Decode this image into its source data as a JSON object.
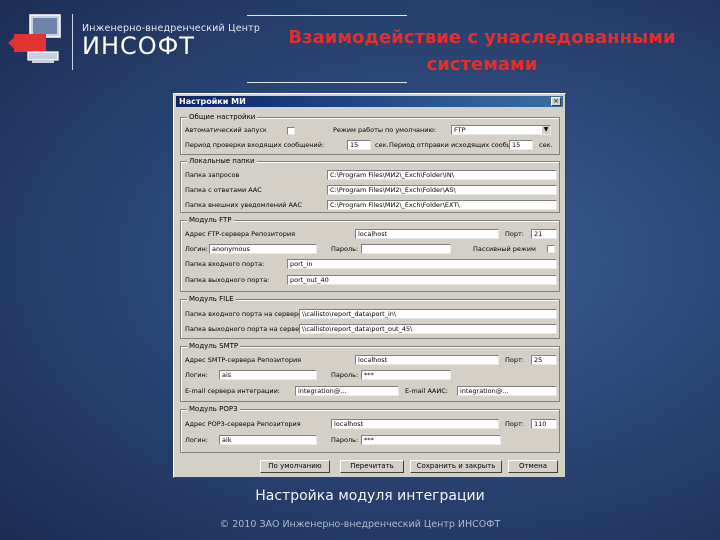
{
  "header": {
    "logo_small": "Инженерно-внедренческий Центр",
    "logo_name": "ИНСОФТ",
    "title_line1": "Взаимодействие с унаследованными",
    "title_line2": "системами"
  },
  "caption": "Настройка модуля интеграции",
  "footer": "© 2010 ЗАО Инженерно-внедренческий Центр ИНСОФТ",
  "colors": {
    "title_red": "#e32e2e",
    "dialog_bg": "#d4d0c8",
    "titlebar": "#0a246a"
  },
  "dialog": {
    "title": "Настройки МИ",
    "close_label": "×",
    "general": {
      "legend": "Общие настройки",
      "autostart_label": "Автоматический запуск",
      "autostart_checked": false,
      "mode_label": "Режим работы по умолчанию:",
      "mode_value": "FTP",
      "poll_label": "Период проверки входящих сообщений:",
      "poll_value": "15",
      "poll_unit": "сек.",
      "outgoing_label": "Период отправки исходящих сообщений:",
      "outgoing_value": "15",
      "outgoing_unit": "сек."
    },
    "local": {
      "legend": "Локальные папки",
      "requests_label": "Папка запросов",
      "requests_value": "C:\\Program Files\\МИ2\\_Exch\\Folder\\IN\\",
      "answers_label": "Папка с ответами ААС",
      "answers_value": "C:\\Program Files\\МИ2\\_Exch\\Folder\\AS\\",
      "external_label": "Папка внешних уведомлений ААС",
      "external_value": "C:\\Program Files\\МИ2\\_Exch\\Folder\\EXT\\"
    },
    "ftp": {
      "legend": "Модуль FTP",
      "server_label": "Адрес FTP-сервера Репозитория",
      "server_value": "localhost",
      "port_label": "Порт:",
      "port_value": "21",
      "login_label": "Логин:",
      "login_value": "anonymous",
      "password_label": "Пароль:",
      "password_value": "",
      "passive_label": "Пассивный режим",
      "passive_checked": false,
      "in_port_label": "Папка входного порта:",
      "in_port_value": "port_in",
      "out_port_label": "Папка выходного порта:",
      "out_port_value": "port_out_40"
    },
    "file": {
      "legend": "Модуль FILE",
      "in_label": "Папка входного порта на сервере:",
      "in_value": "\\\\callisto\\report_data\\port_in\\",
      "out_label": "Папка выходного порта на сервере:",
      "out_value": "\\\\callisto\\report_data\\port_out_45\\"
    },
    "smtp": {
      "legend": "Модуль SMTP",
      "server_label": "Адрес SMTP-сервера Репозитория",
      "server_value": "localhost",
      "port_label": "Порт:",
      "port_value": "25",
      "login_label": "Логин:",
      "login_value": "ais",
      "password_label": "Пароль:",
      "password_value": "***",
      "email_label": "E-mail сервера интеграции:",
      "email_value": "integration@...",
      "aais_label": "E-mail ААИС:",
      "aais_value": "integration@..."
    },
    "pop3": {
      "legend": "Модуль POP3",
      "server_label": "Адрес POP3-сервера Репозитория",
      "server_value": "localhost",
      "port_label": "Порт:",
      "port_value": "110",
      "login_label": "Логин:",
      "login_value": "aik",
      "password_label": "Пароль:",
      "password_value": "***"
    },
    "buttons": {
      "defaults": "По умолчанию",
      "reread": "Перечитать",
      "save_close": "Сохранить и закрыть",
      "cancel": "Отмена"
    }
  }
}
